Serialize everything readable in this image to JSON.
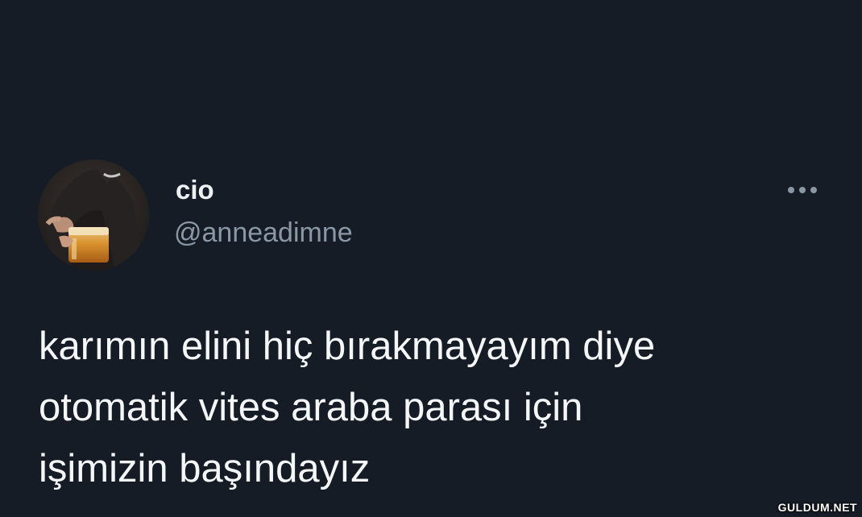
{
  "tweet": {
    "author": {
      "display_name": "cio",
      "handle": "@anneadimne",
      "avatar_icon": "profile-photo"
    },
    "more_icon": "more-options-icon",
    "text_lines": [
      "karımın elini hiç bırakmayayım diye",
      "otomatik vites araba parası için",
      "işimizin başındayız"
    ]
  },
  "watermark": "GULDUM.NET",
  "colors": {
    "background": "#161c26",
    "primary_text": "#f4f6f8",
    "secondary_text": "#8a98a6"
  }
}
